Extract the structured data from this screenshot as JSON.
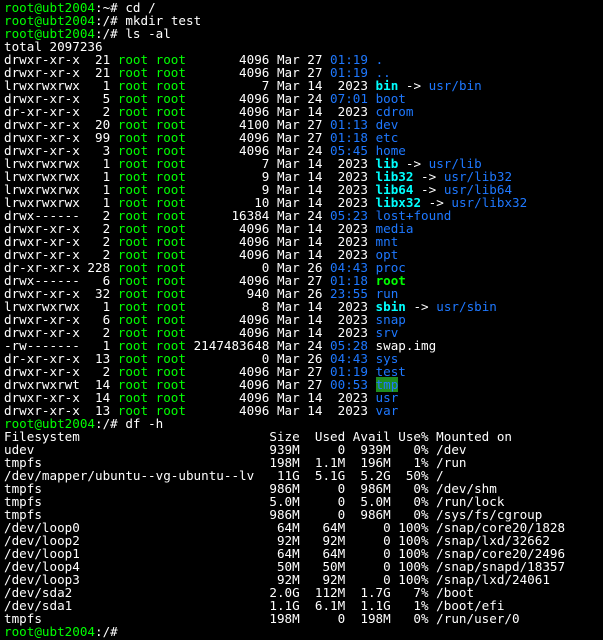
{
  "colors": {
    "background": "#000000",
    "default": "#ffffff",
    "user": "#00ff00",
    "dir": "#1e78ff",
    "link": "#00ffff",
    "exec": "#00ff00",
    "other_writable_bg": "#1e8c1e"
  },
  "terminal": {
    "lines": [
      [
        {
          "t": "root@ubt2004",
          "c": "user"
        },
        {
          "t": ":~# cd /"
        }
      ],
      [
        {
          "t": "root@ubt2004",
          "c": "user"
        },
        {
          "t": ":/# mkdir test"
        }
      ],
      [
        {
          "t": "root@ubt2004",
          "c": "user"
        },
        {
          "t": ":/# ls -al"
        }
      ],
      [
        {
          "t": "total 2097236"
        }
      ],
      [
        {
          "t": "drwxr-xr-x  21 "
        },
        {
          "t": "root root",
          "c": "user"
        },
        {
          "t": "       4096 Mar 27 "
        },
        {
          "t": "01:19",
          "c": "dir"
        },
        {
          "t": " "
        },
        {
          "t": ".",
          "c": "dir"
        }
      ],
      [
        {
          "t": "drwxr-xr-x  21 "
        },
        {
          "t": "root root",
          "c": "user"
        },
        {
          "t": "       4096 Mar 27 "
        },
        {
          "t": "01:19",
          "c": "dir"
        },
        {
          "t": " "
        },
        {
          "t": "..",
          "c": "dir"
        }
      ],
      [
        {
          "t": "lrwxrwxrwx   1 "
        },
        {
          "t": "root root",
          "c": "user"
        },
        {
          "t": "          7 Mar 14  2023 "
        },
        {
          "t": "bin",
          "c": "link",
          "b": true
        },
        {
          "t": " -> "
        },
        {
          "t": "usr/bin",
          "c": "dir"
        }
      ],
      [
        {
          "t": "drwxr-xr-x   5 "
        },
        {
          "t": "root root",
          "c": "user"
        },
        {
          "t": "       4096 Mar 24 "
        },
        {
          "t": "07:01",
          "c": "dir"
        },
        {
          "t": " "
        },
        {
          "t": "boot",
          "c": "dir"
        }
      ],
      [
        {
          "t": "dr-xr-xr-x   2 "
        },
        {
          "t": "root root",
          "c": "user"
        },
        {
          "t": "       4096 Mar 14  2023 "
        },
        {
          "t": "cdrom",
          "c": "dir"
        }
      ],
      [
        {
          "t": "drwxr-xr-x  20 "
        },
        {
          "t": "root root",
          "c": "user"
        },
        {
          "t": "       4100 Mar 27 "
        },
        {
          "t": "01:13",
          "c": "dir"
        },
        {
          "t": " "
        },
        {
          "t": "dev",
          "c": "dir"
        }
      ],
      [
        {
          "t": "drwxr-xr-x  99 "
        },
        {
          "t": "root root",
          "c": "user"
        },
        {
          "t": "       4096 Mar 27 "
        },
        {
          "t": "01:18",
          "c": "dir"
        },
        {
          "t": " "
        },
        {
          "t": "etc",
          "c": "dir"
        }
      ],
      [
        {
          "t": "drwxr-xr-x   3 "
        },
        {
          "t": "root root",
          "c": "user"
        },
        {
          "t": "       4096 Mar 24 "
        },
        {
          "t": "05:45",
          "c": "dir"
        },
        {
          "t": " "
        },
        {
          "t": "home",
          "c": "dir"
        }
      ],
      [
        {
          "t": "lrwxrwxrwx   1 "
        },
        {
          "t": "root root",
          "c": "user"
        },
        {
          "t": "          7 Mar 14  2023 "
        },
        {
          "t": "lib",
          "c": "link",
          "b": true
        },
        {
          "t": " -> "
        },
        {
          "t": "usr/lib",
          "c": "dir"
        }
      ],
      [
        {
          "t": "lrwxrwxrwx   1 "
        },
        {
          "t": "root root",
          "c": "user"
        },
        {
          "t": "          9 Mar 14  2023 "
        },
        {
          "t": "lib32",
          "c": "link",
          "b": true
        },
        {
          "t": " -> "
        },
        {
          "t": "usr/lib32",
          "c": "dir"
        }
      ],
      [
        {
          "t": "lrwxrwxrwx   1 "
        },
        {
          "t": "root root",
          "c": "user"
        },
        {
          "t": "          9 Mar 14  2023 "
        },
        {
          "t": "lib64",
          "c": "link",
          "b": true
        },
        {
          "t": " -> "
        },
        {
          "t": "usr/lib64",
          "c": "dir"
        }
      ],
      [
        {
          "t": "lrwxrwxrwx   1 "
        },
        {
          "t": "root root",
          "c": "user"
        },
        {
          "t": "         10 Mar 14  2023 "
        },
        {
          "t": "libx32",
          "c": "link",
          "b": true
        },
        {
          "t": " -> "
        },
        {
          "t": "usr/libx32",
          "c": "dir"
        }
      ],
      [
        {
          "t": "drwx------   2 "
        },
        {
          "t": "root root",
          "c": "user"
        },
        {
          "t": "      16384 Mar 24 "
        },
        {
          "t": "05:23",
          "c": "dir"
        },
        {
          "t": " "
        },
        {
          "t": "lost+found",
          "c": "dir"
        }
      ],
      [
        {
          "t": "drwxr-xr-x   2 "
        },
        {
          "t": "root root",
          "c": "user"
        },
        {
          "t": "       4096 Mar 14  2023 "
        },
        {
          "t": "media",
          "c": "dir"
        }
      ],
      [
        {
          "t": "drwxr-xr-x   2 "
        },
        {
          "t": "root root",
          "c": "user"
        },
        {
          "t": "       4096 Mar 14  2023 "
        },
        {
          "t": "mnt",
          "c": "dir"
        }
      ],
      [
        {
          "t": "drwxr-xr-x   2 "
        },
        {
          "t": "root root",
          "c": "user"
        },
        {
          "t": "       4096 Mar 14  2023 "
        },
        {
          "t": "opt",
          "c": "dir"
        }
      ],
      [
        {
          "t": "dr-xr-xr-x 228 "
        },
        {
          "t": "root root",
          "c": "user"
        },
        {
          "t": "          0 Mar 26 "
        },
        {
          "t": "04:43",
          "c": "dir"
        },
        {
          "t": " "
        },
        {
          "t": "proc",
          "c": "dir"
        }
      ],
      [
        {
          "t": "drwx------   6 "
        },
        {
          "t": "root root",
          "c": "user"
        },
        {
          "t": "       4096 Mar 27 "
        },
        {
          "t": "01:18",
          "c": "dir"
        },
        {
          "t": " "
        },
        {
          "t": "root",
          "c": "exec",
          "b": true
        }
      ],
      [
        {
          "t": "drwxr-xr-x  32 "
        },
        {
          "t": "root root",
          "c": "user"
        },
        {
          "t": "        940 Mar 26 "
        },
        {
          "t": "23:55",
          "c": "dir"
        },
        {
          "t": " "
        },
        {
          "t": "run",
          "c": "dir"
        }
      ],
      [
        {
          "t": "lrwxrwxrwx   1 "
        },
        {
          "t": "root root",
          "c": "user"
        },
        {
          "t": "          8 Mar 14  2023 "
        },
        {
          "t": "sbin",
          "c": "link",
          "b": true
        },
        {
          "t": " -> "
        },
        {
          "t": "usr/sbin",
          "c": "dir"
        }
      ],
      [
        {
          "t": "drwxr-xr-x   6 "
        },
        {
          "t": "root root",
          "c": "user"
        },
        {
          "t": "       4096 Mar 14  2023 "
        },
        {
          "t": "snap",
          "c": "dir"
        }
      ],
      [
        {
          "t": "drwxr-xr-x   2 "
        },
        {
          "t": "root root",
          "c": "user"
        },
        {
          "t": "       4096 Mar 14  2023 "
        },
        {
          "t": "srv",
          "c": "dir"
        }
      ],
      [
        {
          "t": "-rw-------   1 "
        },
        {
          "t": "root root",
          "c": "user"
        },
        {
          "t": " 2147483648 Mar 24 "
        },
        {
          "t": "05:28",
          "c": "dir"
        },
        {
          "t": " swap.img"
        }
      ],
      [
        {
          "t": "dr-xr-xr-x  13 "
        },
        {
          "t": "root root",
          "c": "user"
        },
        {
          "t": "          0 Mar 26 "
        },
        {
          "t": "04:43",
          "c": "dir"
        },
        {
          "t": " "
        },
        {
          "t": "sys",
          "c": "dir"
        }
      ],
      [
        {
          "t": "drwxr-xr-x   2 "
        },
        {
          "t": "root root",
          "c": "user"
        },
        {
          "t": "       4096 Mar 27 "
        },
        {
          "t": "01:19",
          "c": "dir"
        },
        {
          "t": " "
        },
        {
          "t": "test",
          "c": "dir"
        }
      ],
      [
        {
          "t": "drwxrwxrwt  14 "
        },
        {
          "t": "root root",
          "c": "user"
        },
        {
          "t": "       4096 Mar 27 "
        },
        {
          "t": "00:53",
          "c": "dir"
        },
        {
          "t": " "
        },
        {
          "t": "tmp",
          "c": "dir",
          "bg": "other_writable_bg"
        }
      ],
      [
        {
          "t": "drwxr-xr-x  14 "
        },
        {
          "t": "root root",
          "c": "user"
        },
        {
          "t": "       4096 Mar 14  2023 "
        },
        {
          "t": "usr",
          "c": "dir"
        }
      ],
      [
        {
          "t": "drwxr-xr-x  13 "
        },
        {
          "t": "root root",
          "c": "user"
        },
        {
          "t": "       4096 Mar 14  2023 "
        },
        {
          "t": "var",
          "c": "dir"
        }
      ],
      [
        {
          "t": "root@ubt2004",
          "c": "user"
        },
        {
          "t": ":/# df -h"
        }
      ],
      [
        {
          "t": "Filesystem                         Size  Used Avail Use% Mounted on"
        }
      ],
      [
        {
          "t": "udev                               939M     0  939M   0% /dev"
        }
      ],
      [
        {
          "t": "tmpfs                              198M  1.1M  196M   1% /run"
        }
      ],
      [
        {
          "t": "/dev/mapper/ubuntu--vg-ubuntu--lv   11G  5.1G  5.2G  50% /"
        }
      ],
      [
        {
          "t": "tmpfs                              986M     0  986M   0% /dev/shm"
        }
      ],
      [
        {
          "t": "tmpfs                              5.0M     0  5.0M   0% /run/lock"
        }
      ],
      [
        {
          "t": "tmpfs                              986M     0  986M   0% /sys/fs/cgroup"
        }
      ],
      [
        {
          "t": "/dev/loop0                          64M   64M     0 100% /snap/core20/1828"
        }
      ],
      [
        {
          "t": "/dev/loop2                          92M   92M     0 100% /snap/lxd/32662"
        }
      ],
      [
        {
          "t": "/dev/loop1                          64M   64M     0 100% /snap/core20/2496"
        }
      ],
      [
        {
          "t": "/dev/loop4                          50M   50M     0 100% /snap/snapd/18357"
        }
      ],
      [
        {
          "t": "/dev/loop3                          92M   92M     0 100% /snap/lxd/24061"
        }
      ],
      [
        {
          "t": "/dev/sda2                          2.0G  112M  1.7G   7% /boot"
        }
      ],
      [
        {
          "t": "/dev/sda1                          1.1G  6.1M  1.1G   1% /boot/efi"
        }
      ],
      [
        {
          "t": "tmpfs                              198M     0  198M   0% /run/user/0"
        }
      ],
      [
        {
          "t": "root@ubt2004",
          "c": "user"
        },
        {
          "t": ":/# "
        }
      ]
    ]
  }
}
